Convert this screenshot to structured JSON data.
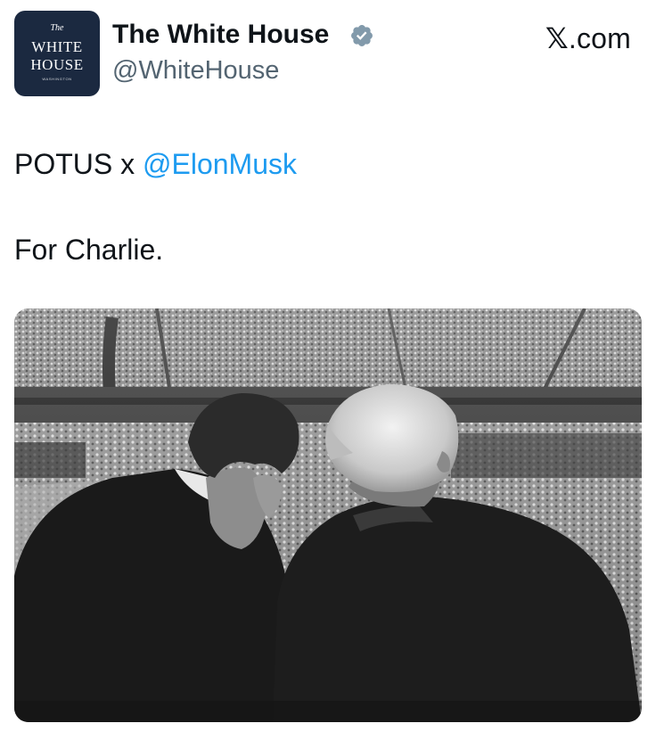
{
  "account": {
    "display_name": "The White House",
    "handle": "@WhiteHouse",
    "verified_icon": "verified-badge-icon",
    "avatar_logo": {
      "line1": "The",
      "line2": "WHITE",
      "line3": "HOUSE",
      "line4": "WASHINGTON"
    }
  },
  "source": {
    "label": "com",
    "logo_glyph": "𝕏",
    "logo_icon": "x-logo-icon"
  },
  "tweet": {
    "text_prefix": "POTUS x ",
    "mention": "@ElonMusk",
    "line2": "For Charlie."
  },
  "media": {
    "kind": "photo",
    "style": "black-and-white"
  },
  "colors": {
    "text": "#0f1419",
    "secondary_text": "#536471",
    "link": "#1d9bf0",
    "verified_badge": "#829aab",
    "avatar_bg": "#1b2940"
  }
}
